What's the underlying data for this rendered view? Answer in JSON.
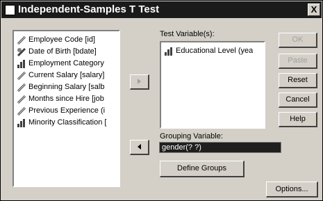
{
  "window": {
    "title": "Independent-Samples T Test",
    "close_label": "X"
  },
  "variable_list": [
    {
      "label": "Employee Code [id]",
      "icon": "ruler-icon"
    },
    {
      "label": "Date of Birth [bdate]",
      "icon": "date-ruler-icon"
    },
    {
      "label": "Employment Category",
      "icon": "bar-chart-icon"
    },
    {
      "label": "Current Salary [salary]",
      "icon": "ruler-icon"
    },
    {
      "label": "Beginning Salary [salb",
      "icon": "ruler-icon"
    },
    {
      "label": "Months since Hire [job",
      "icon": "ruler-icon"
    },
    {
      "label": "Previous Experience (i",
      "icon": "ruler-icon"
    },
    {
      "label": "Minority Classification [",
      "icon": "bar-chart-icon"
    }
  ],
  "test_variables": {
    "label": "Test Variable(s):",
    "items": [
      {
        "label": "Educational Level (yea",
        "icon": "bar-chart-icon"
      }
    ]
  },
  "grouping": {
    "label": "Grouping Variable:",
    "value": "gender(? ?)"
  },
  "buttons": {
    "ok": "OK",
    "paste": "Paste",
    "reset": "Reset",
    "cancel": "Cancel",
    "help": "Help",
    "define_groups": "Define Groups",
    "options": "Options..."
  },
  "colors": {
    "dialog_bg": "#d4d0c8",
    "titlebar_bg": "#1a1a1a",
    "selection_bg": "#1f1f1f"
  }
}
